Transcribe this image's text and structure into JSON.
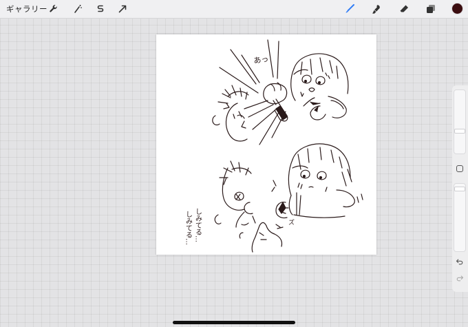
{
  "toolbar": {
    "gallery_label": "ギャラリー",
    "left_tools": [
      "wrench-icon",
      "magic-wand-icon",
      "selection-icon",
      "transform-arrow-icon"
    ],
    "right_tools": [
      "brush-icon",
      "smudge-icon",
      "eraser-icon",
      "layers-icon"
    ],
    "active_tool": "brush-icon",
    "accent_color": "#2f7cf6",
    "current_color": "#3b0d10"
  },
  "canvas": {
    "background": "#ffffff",
    "ink_color": "#2a1a1a",
    "panel1": {
      "sfx_text": "あっ"
    },
    "panel2": {
      "dialogue_line1": "しみてる…",
      "dialogue_line2": "しみてる…",
      "sfx_text": "ズ"
    }
  },
  "sidebar": {
    "tools": [
      "brush-size-slider",
      "modify-button",
      "opacity-slider",
      "undo-icon",
      "redo-icon"
    ]
  }
}
